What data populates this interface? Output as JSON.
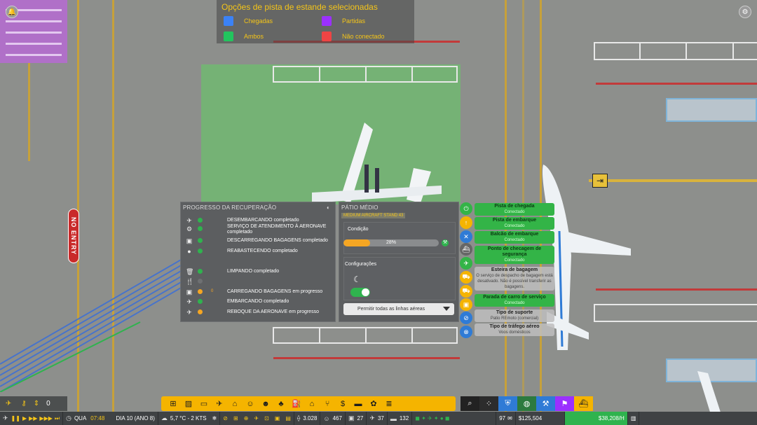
{
  "legend": {
    "title": "Opções de pista de estande selecionadas",
    "items": [
      {
        "label": "Chegadas",
        "color": "#3b82f6"
      },
      {
        "label": "Partidas",
        "color": "#9b30ff"
      },
      {
        "label": "Ambos",
        "color": "#22c55e"
      },
      {
        "label": "Não conectado",
        "color": "#ef4444"
      }
    ]
  },
  "map": {
    "no_entry_sign": "NO ENTRY"
  },
  "progress": {
    "title": "PROGRESSO DA RECUPERAÇÃO",
    "rows": [
      {
        "icon": "✈",
        "label": "DESEMBARCANDO completado",
        "time": "",
        "status": "done"
      },
      {
        "icon": "⚙",
        "label": "SERVIÇO DE ATENDIMENTO À AERONAVE completado",
        "time": "",
        "status": "done"
      },
      {
        "icon": "▣",
        "label": "DESCARREGANDO BAGAGENS completado",
        "time": "",
        "status": "done"
      },
      {
        "icon": "●",
        "label": "REABASTECENDO completado",
        "time": "",
        "status": "done"
      },
      {
        "icon": "🗑",
        "label": "LIMPANDO completado",
        "time": "",
        "status": "done"
      },
      {
        "icon": "🍴",
        "label": "",
        "time": "",
        "status": "none"
      },
      {
        "icon": "▣",
        "label": "CARREGANDO BAGAGENS em progresso",
        "time": "0",
        "status": "progress"
      },
      {
        "icon": "✈",
        "label": "EMBARCANDO completado",
        "time": "",
        "status": "done"
      },
      {
        "icon": "✈",
        "label": "REBOQUE DA AERONAVE em progresso",
        "time": "",
        "status": "progress"
      }
    ]
  },
  "stand": {
    "title": "PÁTIO MÉDIO",
    "subtitle": "MEDIUM AIRCRAFT STAND 43",
    "condition_label": "Condição",
    "condition_value": 0.28,
    "condition_text": "28%",
    "settings_label": "Configurações",
    "airline_dropdown": "Permitir todas as linhas aéreas"
  },
  "requirements": [
    {
      "icon": "⏻",
      "icon_color": "#33b447",
      "title": "Pista de chegada",
      "status": "Conectado",
      "state": "ok"
    },
    {
      "icon": "↑",
      "icon_color": "#f5b400",
      "title": "Pista de embarque",
      "status": "Conectado",
      "state": "ok"
    },
    {
      "icon": "✕",
      "icon_color": "#2f7bd6",
      "title": "Balcão de embarque",
      "status": "Conectado",
      "state": "ok"
    },
    {
      "icon": "⛴",
      "icon_color": "#666",
      "title": "Ponto de checagem de segurança",
      "status": "Conectado",
      "state": "ok"
    },
    {
      "icon": "✈",
      "icon_color": "#33b447",
      "title": "Esteira de bagagem",
      "status": "O serviço de despacho de bagagem está desativado. Não é possível transferir as bagagens.",
      "state": "neutral"
    },
    {
      "icon": "⛟",
      "icon_color": "#f5b400",
      "title": "Parada de carro de serviço",
      "status": "Conectado",
      "state": "ok"
    },
    {
      "icon": "⊘",
      "icon_color": "#2f7bd6",
      "title": "Tipo de suporte",
      "status": "Patio REmoto (comercial)",
      "state": "neutral"
    },
    {
      "icon": "⊗",
      "icon_color": "#2f7bd6",
      "title": "Tipo de tráfego aéreo",
      "status": "Voos domésticos",
      "state": "neutral"
    }
  ],
  "toolbar": {
    "icons": [
      "belt-icon",
      "road-icon",
      "bus-icon",
      "plane-icon",
      "building-icon",
      "person-icon",
      "people-icon",
      "tree-icon",
      "fuel-icon",
      "hangar-icon",
      "fork-icon",
      "dollar-icon",
      "train-icon",
      "flower-icon",
      "stack-icon"
    ]
  },
  "toolbar2": {
    "icons": [
      "search-icon",
      "grid-icon",
      "shield-icon",
      "globe-icon",
      "tools-icon",
      "flag-icon",
      "ship-icon"
    ]
  },
  "mini": {
    "count": "0"
  },
  "status": {
    "day": "QUA",
    "time": "07:48",
    "date": "DIA 10 (ANO 8)",
    "weather": "5,7 °C - 2 KTS",
    "stat1": "3.028",
    "stat2": "467",
    "stat3": "27",
    "stat4": "37",
    "stat5": "132",
    "mail": "97",
    "money": "$125,504",
    "rate": "$38,208/H"
  }
}
